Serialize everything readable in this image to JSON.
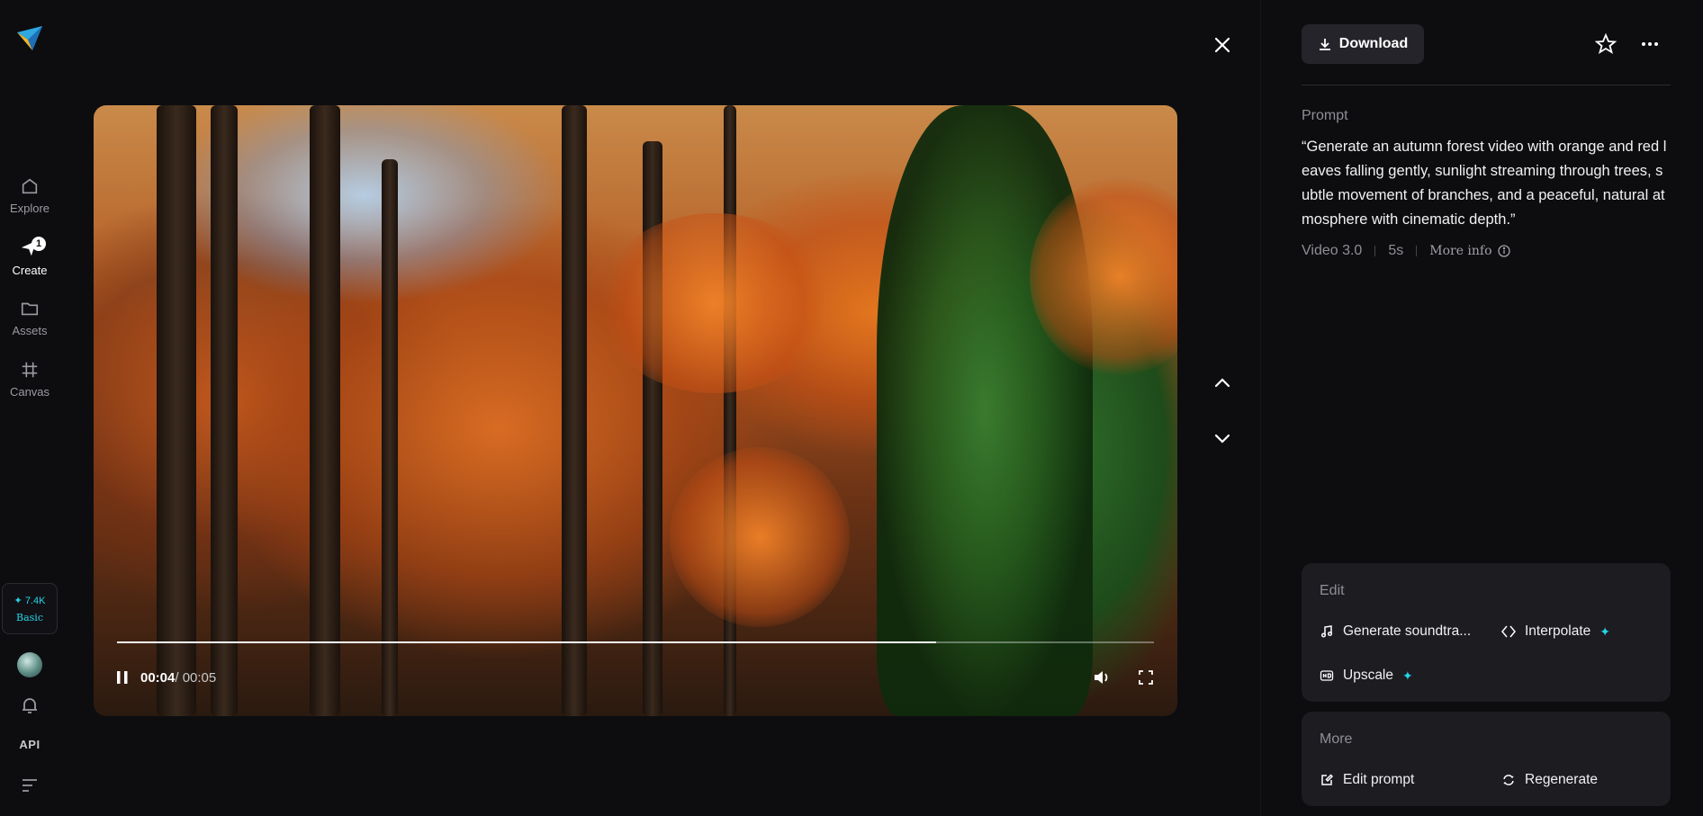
{
  "sidebar": {
    "items": [
      {
        "label": "Explore",
        "icon": "home-icon"
      },
      {
        "label": "Create",
        "icon": "create-icon",
        "badge": "1"
      },
      {
        "label": "Assets",
        "icon": "folder-icon"
      },
      {
        "label": "Canvas",
        "icon": "canvas-icon"
      }
    ],
    "credits": {
      "amount": "7.4K",
      "plan": "Basic"
    },
    "api_label": "API"
  },
  "player": {
    "current_time": "00:04",
    "total_time": " / 00:05",
    "progress": 0.79
  },
  "panel": {
    "download_label": "Download",
    "prompt_label": "Prompt",
    "prompt_text": "“Generate an autumn forest video with orange and red leaves falling gently, sunlight streaming through trees, subtle movement of branches, and a peaceful, natural atmosphere with cinematic depth.”",
    "model": "Video 3.0",
    "duration": "5s",
    "more_info": "More info",
    "edit": {
      "title": "Edit",
      "actions": [
        {
          "label": "Generate soundtra...",
          "icon": "music-note-icon",
          "premium": false
        },
        {
          "label": "Interpolate",
          "icon": "interpolate-icon",
          "premium": true
        },
        {
          "label": "Upscale",
          "icon": "hd-icon",
          "premium": true
        }
      ]
    },
    "more": {
      "title": "More",
      "actions": [
        {
          "label": "Edit prompt",
          "icon": "edit-prompt-icon"
        },
        {
          "label": "Regenerate",
          "icon": "regenerate-icon"
        }
      ]
    }
  },
  "colors": {
    "accent": "#27d3e8",
    "panel_bg": "#1c1c21",
    "page_bg": "#0d0d10"
  }
}
